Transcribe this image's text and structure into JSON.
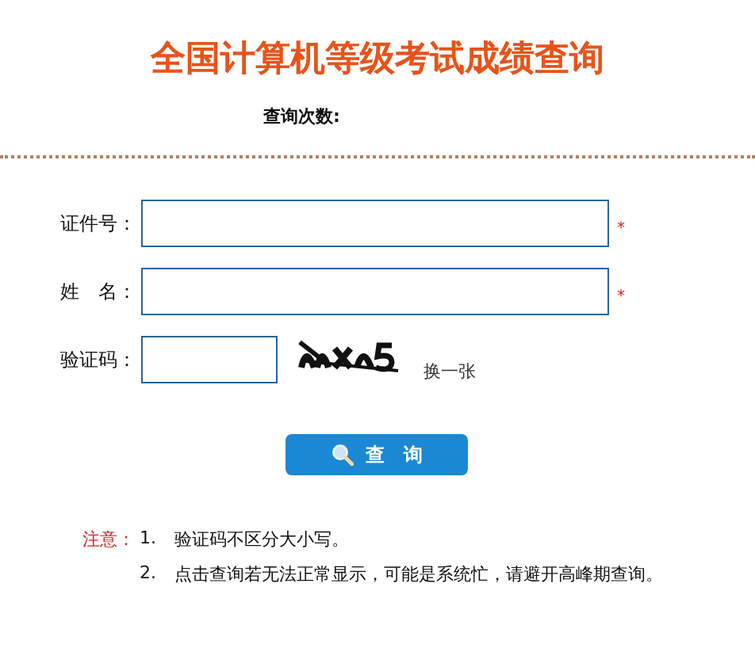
{
  "title": "全国计算机等级考试成绩查询",
  "query_count_label": "查询次数:",
  "fields": [
    {
      "kind": "text",
      "label": "证件号：",
      "required_mark": "*"
    },
    {
      "kind": "text",
      "label": "姓　名：",
      "required_mark": "*"
    },
    {
      "kind": "captcha",
      "label": "验证码：",
      "refresh_link": "换一张"
    }
  ],
  "search_button": "查　询",
  "notes": {
    "label": "注意：",
    "items": [
      {
        "number": "1.",
        "text": "验证码不区分大小写。"
      },
      {
        "number": "2.",
        "text": "点击查询若无法正常显示，可能是系统忙，请避开高峰期查询。"
      }
    ]
  }
}
